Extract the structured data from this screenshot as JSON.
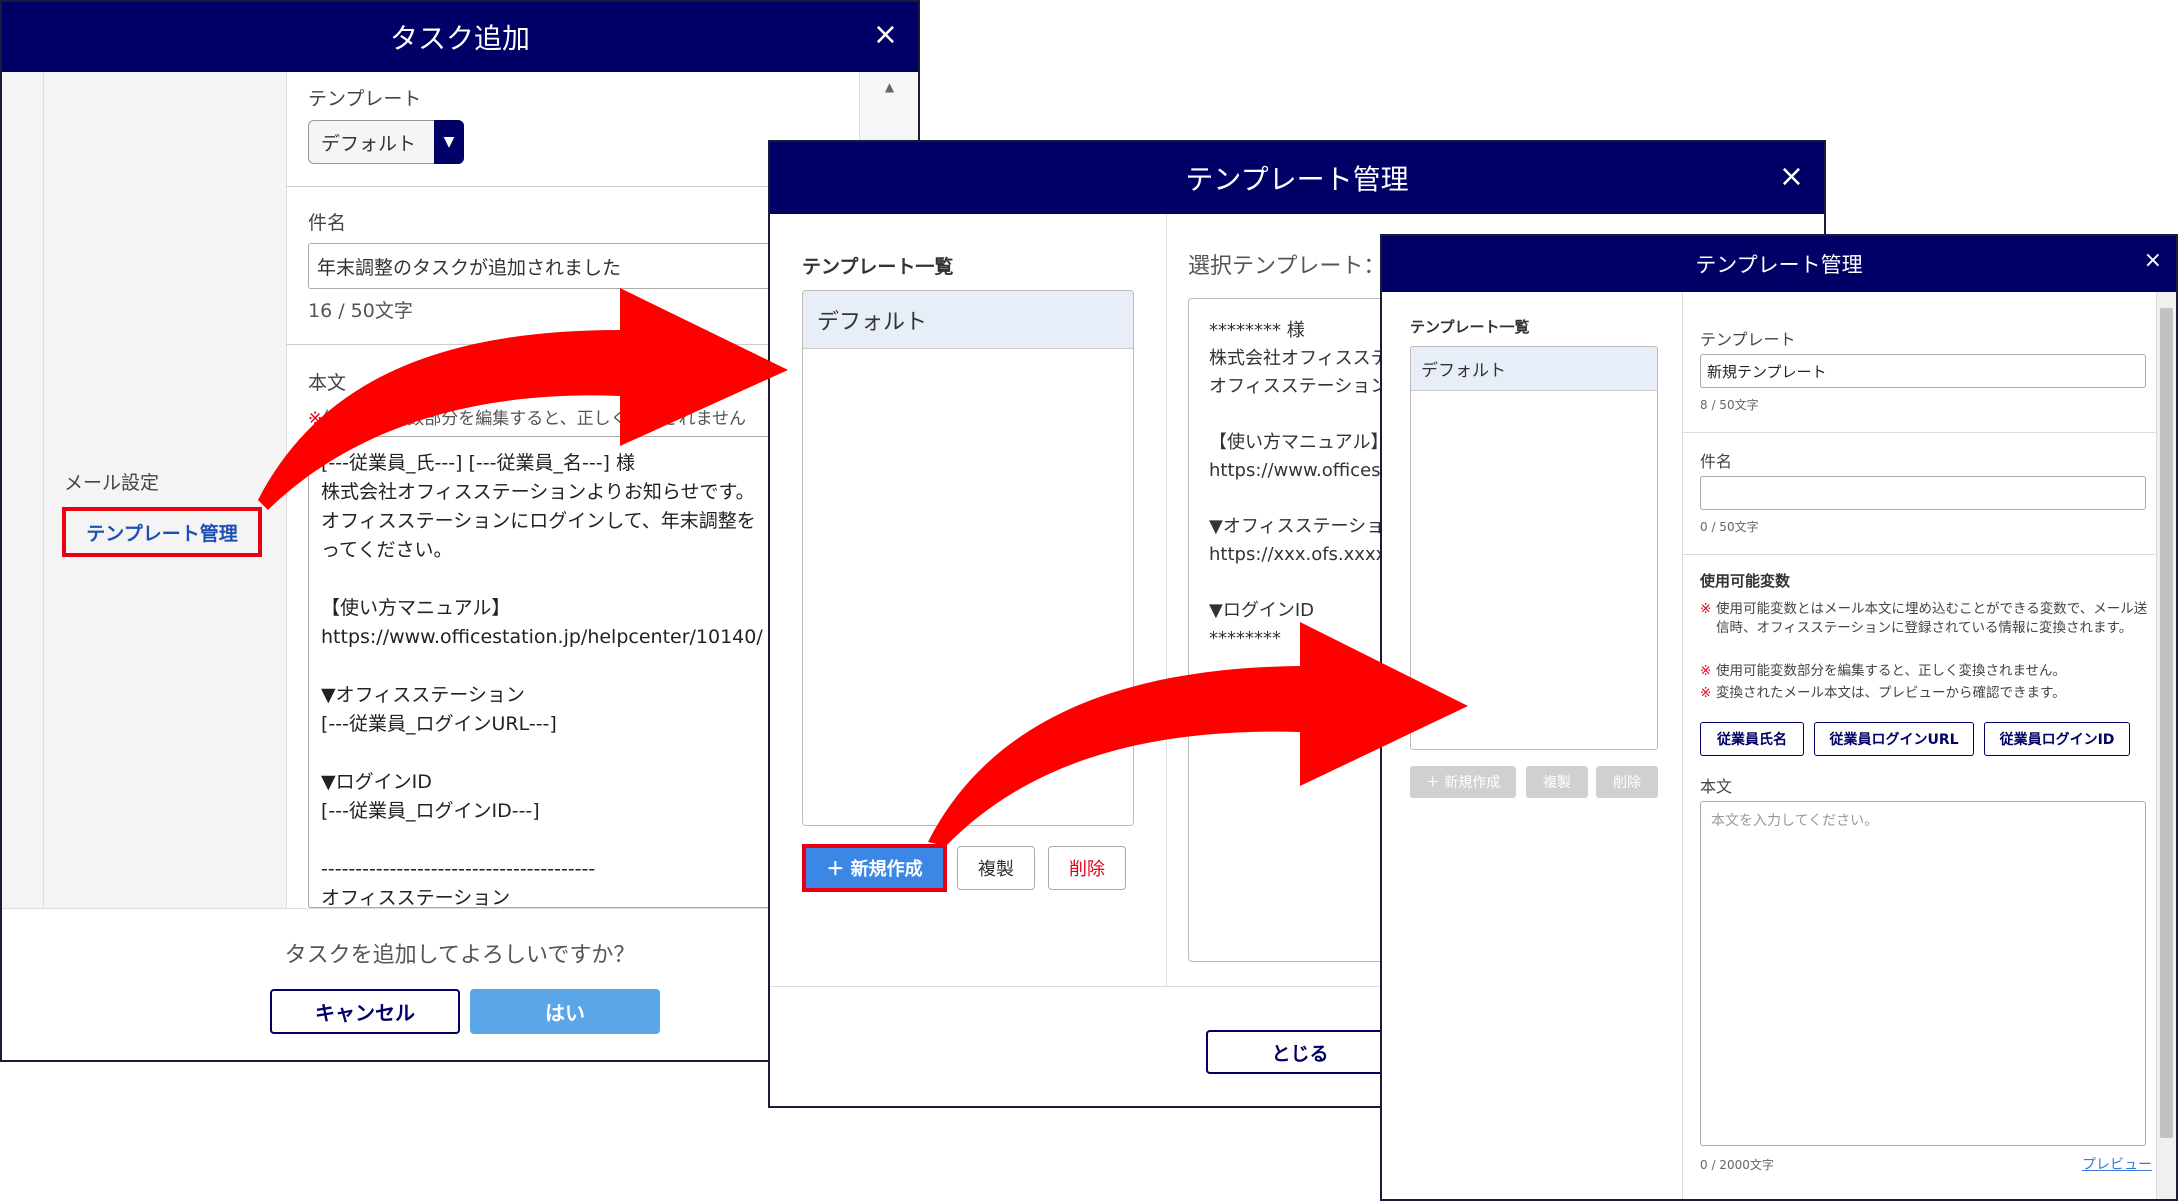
{
  "colors": {
    "header": "#000066",
    "accent_red": "#e60012",
    "primary_blue": "#3c87e6",
    "link_blue": "#1e50b4"
  },
  "task_dialog": {
    "title": "タスク追加",
    "close_icon": "×",
    "mail_setting_label": "メール設定",
    "template_manage_link": "テンプレート管理",
    "template_label": "テンプレート",
    "template_select_value": "デフォルト",
    "subject_label": "件名",
    "subject_value": "年末調整のタスクが追加されました",
    "subject_count": "16 / 50文字",
    "body_label": "本文",
    "body_warning_mark": "※",
    "body_warning": "使用可能変数部分を編集すると、正しく変換されません",
    "body_text": "[---従業員_氏---] [---従業員_名---] 様\n株式会社オフィスステーションよりお知らせです。\nオフィスステーションにログインして、年末調整を\nってください。\n\n【使い方マニュアル】\nhttps://www.officestation.jp/helpcenter/10140/\n\n▼オフィスステーション\n[---従業員_ログインURL---]\n\n▼ログインID\n[---従業員_ログインID---]\n\n----------------------------------------\nオフィスステーション",
    "confirm_text": "タスクを追加してよろしいですか？",
    "cancel_button": "キャンセル",
    "yes_button": "はい"
  },
  "template_dialog": {
    "title": "テンプレート管理",
    "close_icon": "×",
    "list_title": "テンプレート一覧",
    "list_items": [
      "デフォルト"
    ],
    "new_button": "＋ 新規作成",
    "copy_button": "複製",
    "delete_button": "削除",
    "selected_title": "選択テンプレート：デ",
    "preview_text": "******** 様\n株式会社オフィスステ\nオフィスステーション\n\n【使い方マニュアル】\nhttps://www.offices\n\n▼オフィスステーショ\nhttps://xxx.ofs.xxxx\n\n▼ログインID\n********\n\n\n---------------------------",
    "close_button": "とじる"
  },
  "new_template_dialog": {
    "title": "テンプレート管理",
    "close_icon": "×",
    "list_title": "テンプレート一覧",
    "list_items": [
      "デフォルト"
    ],
    "new_button": "＋ 新規作成",
    "copy_button": "複製",
    "delete_button": "削除",
    "template_label": "テンプレート",
    "template_value": "新規テンプレート",
    "template_count": "8 / 50文字",
    "subject_label": "件名",
    "subject_value": "",
    "subject_count": "0 / 50文字",
    "variables_title": "使用可能変数",
    "notes": [
      "使用可能変数とはメール本文に埋め込むことができる変数で、メール送信時、オフィスステーションに登録されている情報に変換されます。",
      "使用可能変数部分を編集すると、正しく変換されません。",
      "変換されたメール本文は、プレビューから確認できます。"
    ],
    "note_mark": "※",
    "variable_buttons": [
      "従業員氏名",
      "従業員ログインURL",
      "従業員ログインID"
    ],
    "body_label": "本文",
    "body_placeholder": "本文を入力してください。",
    "body_count": "0 / 2000文字",
    "preview_link": "プレビュー"
  }
}
